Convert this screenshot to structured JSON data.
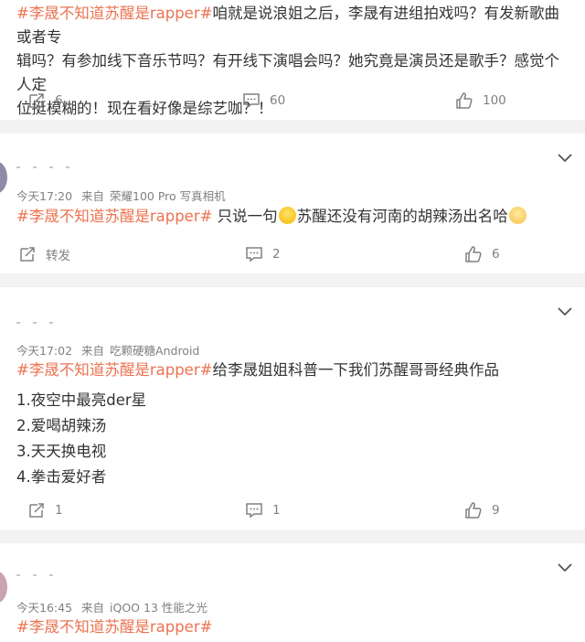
{
  "post": {
    "hashtag": "#李晟不知道苏醒是rapper#",
    "body_line1": "咱就是说浪姐之后，李晟有进组拍戏吗？有发新歌曲或者专",
    "body_line2": "辑吗？有参加线下音乐节吗？有开线下演唱会吗？她究竟是演员还是歌手？感觉个人定",
    "body_line3": "位挺模糊的！现在看好像是综艺咖？！",
    "reposts": "6",
    "comments": "60",
    "likes": "100"
  },
  "comments": [
    {
      "time": "今天17:20",
      "from": "来自",
      "device": "荣耀100 Pro 写真相机",
      "hashtag": "#李晟不知道苏醒是rapper#",
      "text_a": " 只说一句",
      "text_b": "苏醒还没有河南的胡辣汤出名哈",
      "emoji_1": "smile-emoji",
      "emoji_2": "shy-laugh-emoji",
      "repost_label": "转发",
      "comments": "2",
      "likes": "6"
    },
    {
      "time": "今天17:02",
      "from": "来自",
      "device": "吃颗硬糖Android",
      "hashtag": "#李晟不知道苏醒是rapper#",
      "text": "给李晟姐姐科普一下我们苏醒哥哥经典作品",
      "list": [
        "1.夜空中最亮der星",
        "2.爱喝胡辣汤",
        "3.天天换电视",
        "4.拳击爱好者"
      ],
      "reposts": "1",
      "comments": "1",
      "likes": "9"
    },
    {
      "time": "今天16:45",
      "from": "来自",
      "device": "iQOO 13 性能之光",
      "hashtag": "#李晟不知道苏醒是rapper#"
    }
  ],
  "colors": {
    "hashtag": "#eb7350",
    "meta": "#808080",
    "divider": "#f2f2f2"
  }
}
